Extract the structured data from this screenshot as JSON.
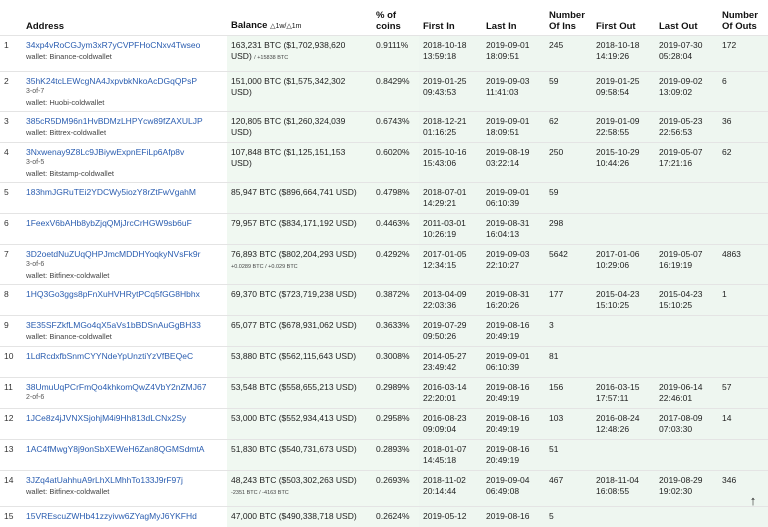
{
  "columns": {
    "rank": "",
    "address": "Address",
    "balance": "Balance",
    "balance_sort": "△1w/△1m",
    "pct": "% of coins",
    "first_in": "First In",
    "last_in": "Last In",
    "num_ins": "Number Of Ins",
    "first_out": "First Out",
    "last_out": "Last Out",
    "num_outs": "Number Of Outs"
  },
  "rows": [
    {
      "rank": "1",
      "address": "34xp4vRoCGJym3xR7yCVPFHoCNxv4Twseo",
      "tag": "",
      "wallet": "wallet: Binance-coldwallet",
      "balance": "163,231 BTC ($1,702,938,620 USD)",
      "delta": "/ +15838 BTC",
      "pct": "0.9111%",
      "first_in": "2018-10-18 13:59:18",
      "last_in": "2019-09-01 18:09:51",
      "num_ins": "245",
      "first_out": "2018-10-18 14:19:26",
      "last_out": "2019-07-30 05:28:04",
      "num_outs": "172"
    },
    {
      "rank": "2",
      "address": "35hK24tcLEWcgNA4JxpvbkNkoAcDGqQPsP",
      "tag": "3-of-7",
      "wallet": "wallet: Huobi-coldwallet",
      "balance": "151,000 BTC ($1,575,342,302 USD)",
      "delta": "",
      "pct": "0.8429%",
      "first_in": "2019-01-25 09:43:53",
      "last_in": "2019-09-03 11:41:03",
      "num_ins": "59",
      "first_out": "2019-01-25 09:58:54",
      "last_out": "2019-09-02 13:09:02",
      "num_outs": "6"
    },
    {
      "rank": "3",
      "address": "385cR5DM96n1HvBDMzLHPYcw89fZAXULJP",
      "tag": "",
      "wallet": "wallet: Bittrex-coldwallet",
      "balance": "120,805 BTC ($1,260,324,039 USD)",
      "delta": "",
      "pct": "0.6743%",
      "first_in": "2018-12-21 01:16:25",
      "last_in": "2019-09-01 18:09:51",
      "num_ins": "62",
      "first_out": "2019-01-09 22:58:55",
      "last_out": "2019-05-23 22:56:53",
      "num_outs": "36"
    },
    {
      "rank": "4",
      "address": "3Nxwenay9Z8Lc9JBiywExpnEFiLp6Afp8v",
      "tag": "3-of-5",
      "wallet": "wallet: Bitstamp-coldwallet",
      "balance": "107,848 BTC ($1,125,151,153 USD)",
      "delta": "",
      "pct": "0.6020%",
      "first_in": "2015-10-16 15:43:06",
      "last_in": "2019-08-19 03:22:14",
      "num_ins": "250",
      "first_out": "2015-10-29 10:44:26",
      "last_out": "2019-05-07 17:21:16",
      "num_outs": "62"
    },
    {
      "rank": "5",
      "address": "183hmJGRuTEi2YDCWy5iozY8rZtFwVgahM",
      "tag": "",
      "wallet": "",
      "balance": "85,947 BTC ($896,664,741 USD)",
      "delta": "",
      "pct": "0.4798%",
      "first_in": "2018-07-01 14:29:21",
      "last_in": "2019-09-01 06:10:39",
      "num_ins": "59",
      "first_out": "",
      "last_out": "",
      "num_outs": ""
    },
    {
      "rank": "6",
      "address": "1FeexV6bAHb8ybZjqQMjJrcCrHGW9sb6uF",
      "tag": "",
      "wallet": "",
      "balance": "79,957 BTC ($834,171,192 USD)",
      "delta": "",
      "pct": "0.4463%",
      "first_in": "2011-03-01 10:26:19",
      "last_in": "2019-08-31 16:04:13",
      "num_ins": "298",
      "first_out": "",
      "last_out": "",
      "num_outs": ""
    },
    {
      "rank": "7",
      "address": "3D2oetdNuZUqQHPJmcMDDHYoqkyNVsFk9r",
      "tag": "3-of-6",
      "wallet": "wallet: Bitfinex-coldwallet",
      "balance": "76,893 BTC ($802,204,293 USD)",
      "delta": "+0.0289 BTC / +0.029 BTC",
      "pct": "0.4292%",
      "first_in": "2017-01-05 12:34:15",
      "last_in": "2019-09-03 22:10:27",
      "num_ins": "5642",
      "first_out": "2017-01-06 10:29:06",
      "last_out": "2019-05-07 16:19:19",
      "num_outs": "4863"
    },
    {
      "rank": "8",
      "address": "1HQ3Go3ggs8pFnXuHVHRytPCq5fGG8Hbhx",
      "tag": "",
      "wallet": "",
      "balance": "69,370 BTC ($723,719,238 USD)",
      "delta": "",
      "pct": "0.3872%",
      "first_in": "2013-04-09 22:03:36",
      "last_in": "2019-08-31 16:20:26",
      "num_ins": "177",
      "first_out": "2015-04-23 15:10:25",
      "last_out": "2015-04-23 15:10:25",
      "num_outs": "1"
    },
    {
      "rank": "9",
      "address": "3E35SFZkfLMGo4qX5aVs1bBDSnAuGgBH33",
      "tag": "",
      "wallet": "wallet: Binance-coldwallet",
      "balance": "65,077 BTC ($678,931,062 USD)",
      "delta": "",
      "pct": "0.3633%",
      "first_in": "2019-07-29 09:50:26",
      "last_in": "2019-08-16 20:49:19",
      "num_ins": "3",
      "first_out": "",
      "last_out": "",
      "num_outs": ""
    },
    {
      "rank": "10",
      "address": "1LdRcdxfbSnmCYYNdeYpUnztiYzVfBEQeC",
      "tag": "",
      "wallet": "",
      "balance": "53,880 BTC ($562,115,643 USD)",
      "delta": "",
      "pct": "0.3008%",
      "first_in": "2014-05-27 23:49:42",
      "last_in": "2019-09-01 06:10:39",
      "num_ins": "81",
      "first_out": "",
      "last_out": "",
      "num_outs": ""
    },
    {
      "rank": "11",
      "address": "38UmuUqPCrFmQo4khkomQwZ4VbY2nZMJ67",
      "tag": "2-of-6",
      "wallet": "",
      "balance": "53,548 BTC ($558,655,213 USD)",
      "delta": "",
      "pct": "0.2989%",
      "first_in": "2016-03-14 22:20:01",
      "last_in": "2019-08-16 20:49:19",
      "num_ins": "156",
      "first_out": "2016-03-15 17:57:11",
      "last_out": "2019-06-14 22:46:01",
      "num_outs": "57"
    },
    {
      "rank": "12",
      "address": "1JCe8z4jJVNXSjohjM4i9Hh813dLCNx2Sy",
      "tag": "",
      "wallet": "",
      "balance": "53,000 BTC ($552,934,413 USD)",
      "delta": "",
      "pct": "0.2958%",
      "first_in": "2016-08-23 09:09:04",
      "last_in": "2019-08-16 20:49:19",
      "num_ins": "103",
      "first_out": "2016-08-24 12:48:26",
      "last_out": "2017-08-09 07:03:30",
      "num_outs": "14"
    },
    {
      "rank": "13",
      "address": "1AC4fMwgY8j9onSbXEWeH6Zan8QGMSdmtA",
      "tag": "",
      "wallet": "",
      "balance": "51,830 BTC ($540,731,673 USD)",
      "delta": "",
      "pct": "0.2893%",
      "first_in": "2018-01-07 14:45:18",
      "last_in": "2019-08-16 20:49:19",
      "num_ins": "51",
      "first_out": "",
      "last_out": "",
      "num_outs": ""
    },
    {
      "rank": "14",
      "address": "3JZq4atUahhuA9rLhXLMhhTo133J9rF97j",
      "tag": "",
      "wallet": "wallet: Bitfinex-coldwallet",
      "balance": "48,243 BTC ($503,302,263 USD)",
      "delta": "-2351 BTC / -4163 BTC",
      "pct": "0.2693%",
      "first_in": "2018-11-02 20:14:44",
      "last_in": "2019-09-04 06:49:08",
      "num_ins": "467",
      "first_out": "2018-11-04 16:08:55",
      "last_out": "2019-08-29 19:02:30",
      "num_outs": "346"
    },
    {
      "rank": "15",
      "address": "15VREscuZWHb41zzyivw6ZYagMyJ6YKFHd",
      "tag": "",
      "wallet": "",
      "balance": "47,000 BTC ($490,338,718 USD)",
      "delta": "",
      "pct": "0.2624%",
      "first_in": "2019-05-12",
      "last_in": "2019-08-16",
      "num_ins": "5",
      "first_out": "",
      "last_out": "",
      "num_outs": ""
    }
  ],
  "scroll_top_icon": "arrow-up-icon"
}
